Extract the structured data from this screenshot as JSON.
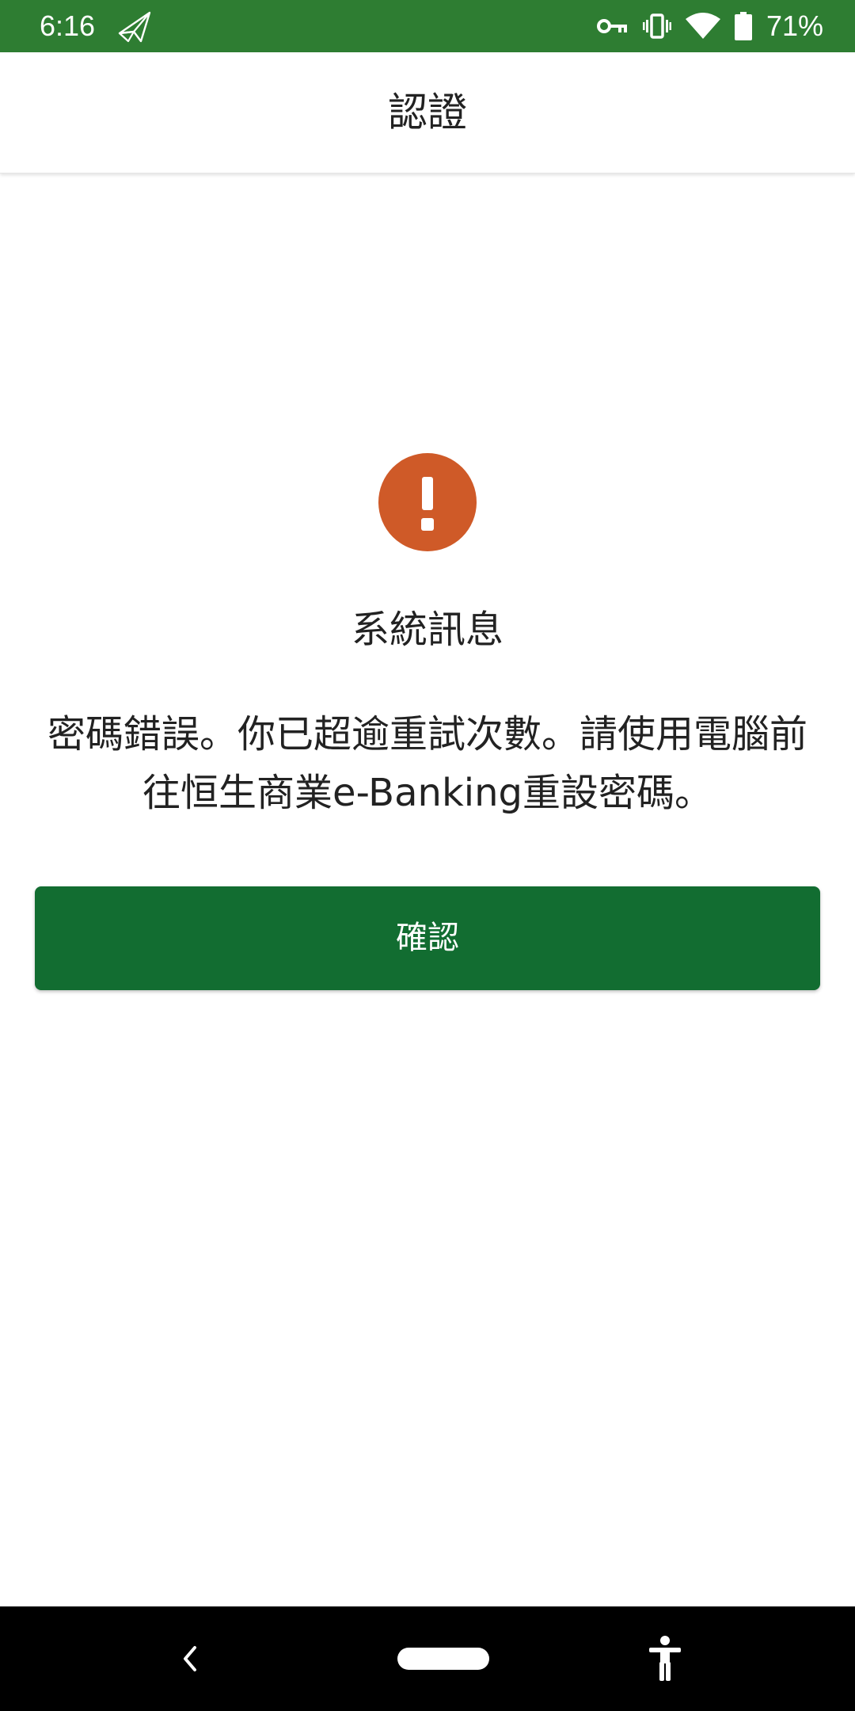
{
  "status_bar": {
    "time": "6:16",
    "battery_percent": "71%",
    "icons": [
      "send-icon",
      "key-icon",
      "vibrate-icon",
      "wifi-icon",
      "battery-icon"
    ],
    "background_color": "#2e7d32"
  },
  "app_bar": {
    "title": "認證"
  },
  "dialog": {
    "icon": "exclamation-icon",
    "icon_color": "#cf5a28",
    "title": "系統訊息",
    "message": "密碼錯誤。你已超逾重試次數。請使用電腦前往恒生商業e-Banking重設密碼。",
    "confirm_label": "確認",
    "confirm_color": "#126d31"
  },
  "nav_bar": {
    "icons": [
      "back-icon",
      "home-pill",
      "accessibility-icon"
    ]
  }
}
